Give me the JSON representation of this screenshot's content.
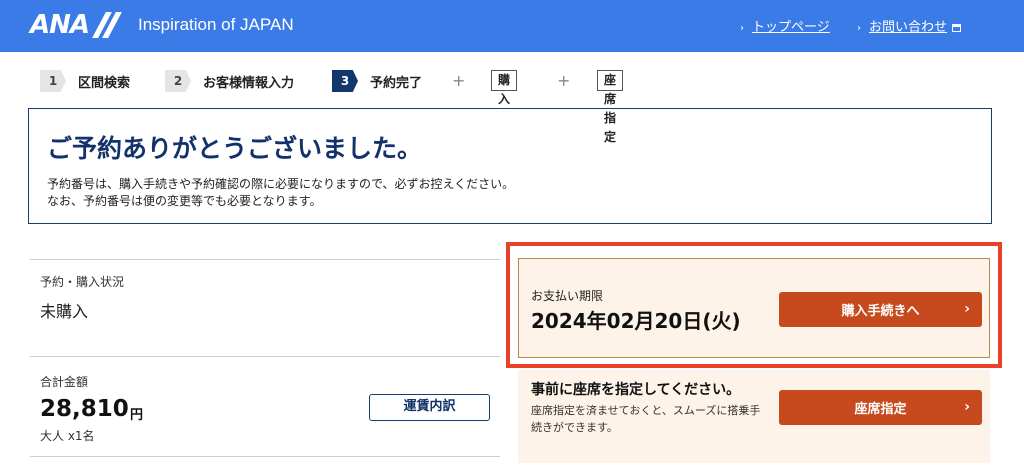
{
  "header": {
    "logo_text": "ANA",
    "tagline": "Inspiration of JAPAN",
    "links": [
      {
        "label": "トップページ"
      },
      {
        "label": "お問い合わせ"
      }
    ]
  },
  "steps": [
    {
      "num": "1",
      "label": "区間検索"
    },
    {
      "num": "2",
      "label": "お客様情報入力"
    },
    {
      "num": "3",
      "label": "予約完了"
    }
  ],
  "extra_steps": {
    "plus": "+",
    "purchase": "購入",
    "seat": "座席指定"
  },
  "thanks": {
    "title": "ご予約ありがとうございました。",
    "line1": "予約番号は、購入手続きや予約確認の際に必要になりますので、必ずお控えください。",
    "line2": "なお、予約番号は便の変更等でも必要となります。"
  },
  "status": {
    "label": "予約・購入状況",
    "value": "未購入"
  },
  "total": {
    "label": "合計金額",
    "amount": "28,810",
    "currency": "円",
    "passengers": "大人 x1名",
    "fare_button": "運賃内訳"
  },
  "payment": {
    "label": "お支払い期限",
    "deadline": "2024年02月20日(火)",
    "button": "購入手続きへ"
  },
  "seat": {
    "title": "事前に座席を指定してください。",
    "description": "座席指定を済ませておくと、スムーズに搭乗手続きができます。",
    "button": "座席指定"
  },
  "colors": {
    "header_bg": "#3b7be8",
    "navy": "#13326a",
    "orange_button": "#c64a1d",
    "highlight_border": "#e84128",
    "panel_bg": "#fdf3e8"
  },
  "icons": [
    "caret-right-icon",
    "external-window-icon",
    "chevron-right-icon"
  ]
}
